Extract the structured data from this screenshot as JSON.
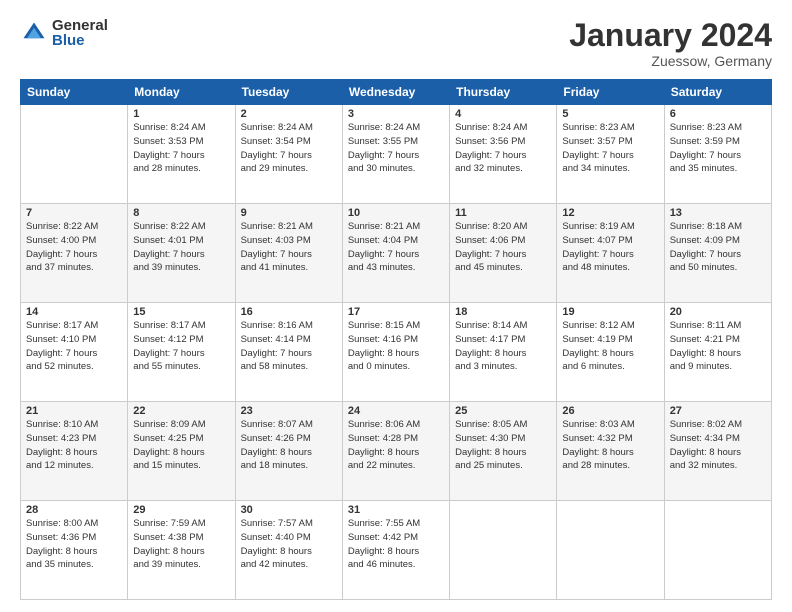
{
  "logo": {
    "general": "General",
    "blue": "Blue"
  },
  "header": {
    "title": "January 2024",
    "subtitle": "Zuessow, Germany"
  },
  "days_of_week": [
    "Sunday",
    "Monday",
    "Tuesday",
    "Wednesday",
    "Thursday",
    "Friday",
    "Saturday"
  ],
  "weeks": [
    [
      {
        "day": "",
        "info": ""
      },
      {
        "day": "1",
        "info": "Sunrise: 8:24 AM\nSunset: 3:53 PM\nDaylight: 7 hours\nand 28 minutes."
      },
      {
        "day": "2",
        "info": "Sunrise: 8:24 AM\nSunset: 3:54 PM\nDaylight: 7 hours\nand 29 minutes."
      },
      {
        "day": "3",
        "info": "Sunrise: 8:24 AM\nSunset: 3:55 PM\nDaylight: 7 hours\nand 30 minutes."
      },
      {
        "day": "4",
        "info": "Sunrise: 8:24 AM\nSunset: 3:56 PM\nDaylight: 7 hours\nand 32 minutes."
      },
      {
        "day": "5",
        "info": "Sunrise: 8:23 AM\nSunset: 3:57 PM\nDaylight: 7 hours\nand 34 minutes."
      },
      {
        "day": "6",
        "info": "Sunrise: 8:23 AM\nSunset: 3:59 PM\nDaylight: 7 hours\nand 35 minutes."
      }
    ],
    [
      {
        "day": "7",
        "info": "Sunrise: 8:22 AM\nSunset: 4:00 PM\nDaylight: 7 hours\nand 37 minutes."
      },
      {
        "day": "8",
        "info": "Sunrise: 8:22 AM\nSunset: 4:01 PM\nDaylight: 7 hours\nand 39 minutes."
      },
      {
        "day": "9",
        "info": "Sunrise: 8:21 AM\nSunset: 4:03 PM\nDaylight: 7 hours\nand 41 minutes."
      },
      {
        "day": "10",
        "info": "Sunrise: 8:21 AM\nSunset: 4:04 PM\nDaylight: 7 hours\nand 43 minutes."
      },
      {
        "day": "11",
        "info": "Sunrise: 8:20 AM\nSunset: 4:06 PM\nDaylight: 7 hours\nand 45 minutes."
      },
      {
        "day": "12",
        "info": "Sunrise: 8:19 AM\nSunset: 4:07 PM\nDaylight: 7 hours\nand 48 minutes."
      },
      {
        "day": "13",
        "info": "Sunrise: 8:18 AM\nSunset: 4:09 PM\nDaylight: 7 hours\nand 50 minutes."
      }
    ],
    [
      {
        "day": "14",
        "info": "Sunrise: 8:17 AM\nSunset: 4:10 PM\nDaylight: 7 hours\nand 52 minutes."
      },
      {
        "day": "15",
        "info": "Sunrise: 8:17 AM\nSunset: 4:12 PM\nDaylight: 7 hours\nand 55 minutes."
      },
      {
        "day": "16",
        "info": "Sunrise: 8:16 AM\nSunset: 4:14 PM\nDaylight: 7 hours\nand 58 minutes."
      },
      {
        "day": "17",
        "info": "Sunrise: 8:15 AM\nSunset: 4:16 PM\nDaylight: 8 hours\nand 0 minutes."
      },
      {
        "day": "18",
        "info": "Sunrise: 8:14 AM\nSunset: 4:17 PM\nDaylight: 8 hours\nand 3 minutes."
      },
      {
        "day": "19",
        "info": "Sunrise: 8:12 AM\nSunset: 4:19 PM\nDaylight: 8 hours\nand 6 minutes."
      },
      {
        "day": "20",
        "info": "Sunrise: 8:11 AM\nSunset: 4:21 PM\nDaylight: 8 hours\nand 9 minutes."
      }
    ],
    [
      {
        "day": "21",
        "info": "Sunrise: 8:10 AM\nSunset: 4:23 PM\nDaylight: 8 hours\nand 12 minutes."
      },
      {
        "day": "22",
        "info": "Sunrise: 8:09 AM\nSunset: 4:25 PM\nDaylight: 8 hours\nand 15 minutes."
      },
      {
        "day": "23",
        "info": "Sunrise: 8:07 AM\nSunset: 4:26 PM\nDaylight: 8 hours\nand 18 minutes."
      },
      {
        "day": "24",
        "info": "Sunrise: 8:06 AM\nSunset: 4:28 PM\nDaylight: 8 hours\nand 22 minutes."
      },
      {
        "day": "25",
        "info": "Sunrise: 8:05 AM\nSunset: 4:30 PM\nDaylight: 8 hours\nand 25 minutes."
      },
      {
        "day": "26",
        "info": "Sunrise: 8:03 AM\nSunset: 4:32 PM\nDaylight: 8 hours\nand 28 minutes."
      },
      {
        "day": "27",
        "info": "Sunrise: 8:02 AM\nSunset: 4:34 PM\nDaylight: 8 hours\nand 32 minutes."
      }
    ],
    [
      {
        "day": "28",
        "info": "Sunrise: 8:00 AM\nSunset: 4:36 PM\nDaylight: 8 hours\nand 35 minutes."
      },
      {
        "day": "29",
        "info": "Sunrise: 7:59 AM\nSunset: 4:38 PM\nDaylight: 8 hours\nand 39 minutes."
      },
      {
        "day": "30",
        "info": "Sunrise: 7:57 AM\nSunset: 4:40 PM\nDaylight: 8 hours\nand 42 minutes."
      },
      {
        "day": "31",
        "info": "Sunrise: 7:55 AM\nSunset: 4:42 PM\nDaylight: 8 hours\nand 46 minutes."
      },
      {
        "day": "",
        "info": ""
      },
      {
        "day": "",
        "info": ""
      },
      {
        "day": "",
        "info": ""
      }
    ]
  ]
}
